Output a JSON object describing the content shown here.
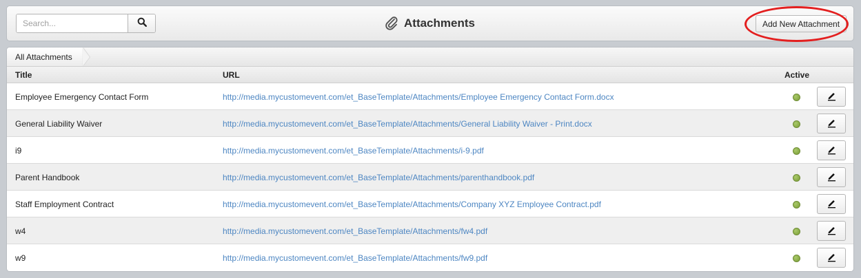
{
  "header": {
    "search_placeholder": "Search...",
    "search_icon": "search-icon",
    "title_icon": "paperclip-icon",
    "title": "Attachments",
    "add_button_label": "Add New Attachment",
    "highlight_color": "#e31f1f"
  },
  "breadcrumb": {
    "label": "All Attachments"
  },
  "table": {
    "columns": [
      "Title",
      "URL",
      "Active"
    ],
    "rows": [
      {
        "title": "Employee Emergency Contact Form",
        "url": "http://media.mycustomevent.com/et_BaseTemplate/Attachments/Employee Emergency Contact Form.docx",
        "active": true,
        "edit_icon": "pencil-icon"
      },
      {
        "title": "General Liability Waiver",
        "url": "http://media.mycustomevent.com/et_BaseTemplate/Attachments/General Liability Waiver - Print.docx",
        "active": true,
        "edit_icon": "pencil-icon"
      },
      {
        "title": "i9",
        "url": "http://media.mycustomevent.com/et_BaseTemplate/Attachments/i-9.pdf",
        "active": true,
        "edit_icon": "pencil-icon"
      },
      {
        "title": "Parent Handbook",
        "url": "http://media.mycustomevent.com/et_BaseTemplate/Attachments/parenthandbook.pdf",
        "active": true,
        "edit_icon": "pencil-icon"
      },
      {
        "title": "Staff Employment Contract",
        "url": "http://media.mycustomevent.com/et_BaseTemplate/Attachments/Company XYZ Employee Contract.pdf",
        "active": true,
        "edit_icon": "pencil-icon"
      },
      {
        "title": "w4",
        "url": "http://media.mycustomevent.com/et_BaseTemplate/Attachments/fw4.pdf",
        "active": true,
        "edit_icon": "pencil-icon"
      },
      {
        "title": "w9",
        "url": "http://media.mycustomevent.com/et_BaseTemplate/Attachments/fw9.pdf",
        "active": true,
        "edit_icon": "pencil-icon"
      }
    ]
  },
  "colors": {
    "link": "#4d86c2",
    "active_dot": "#8aad45",
    "row_alt": "#efefef"
  }
}
